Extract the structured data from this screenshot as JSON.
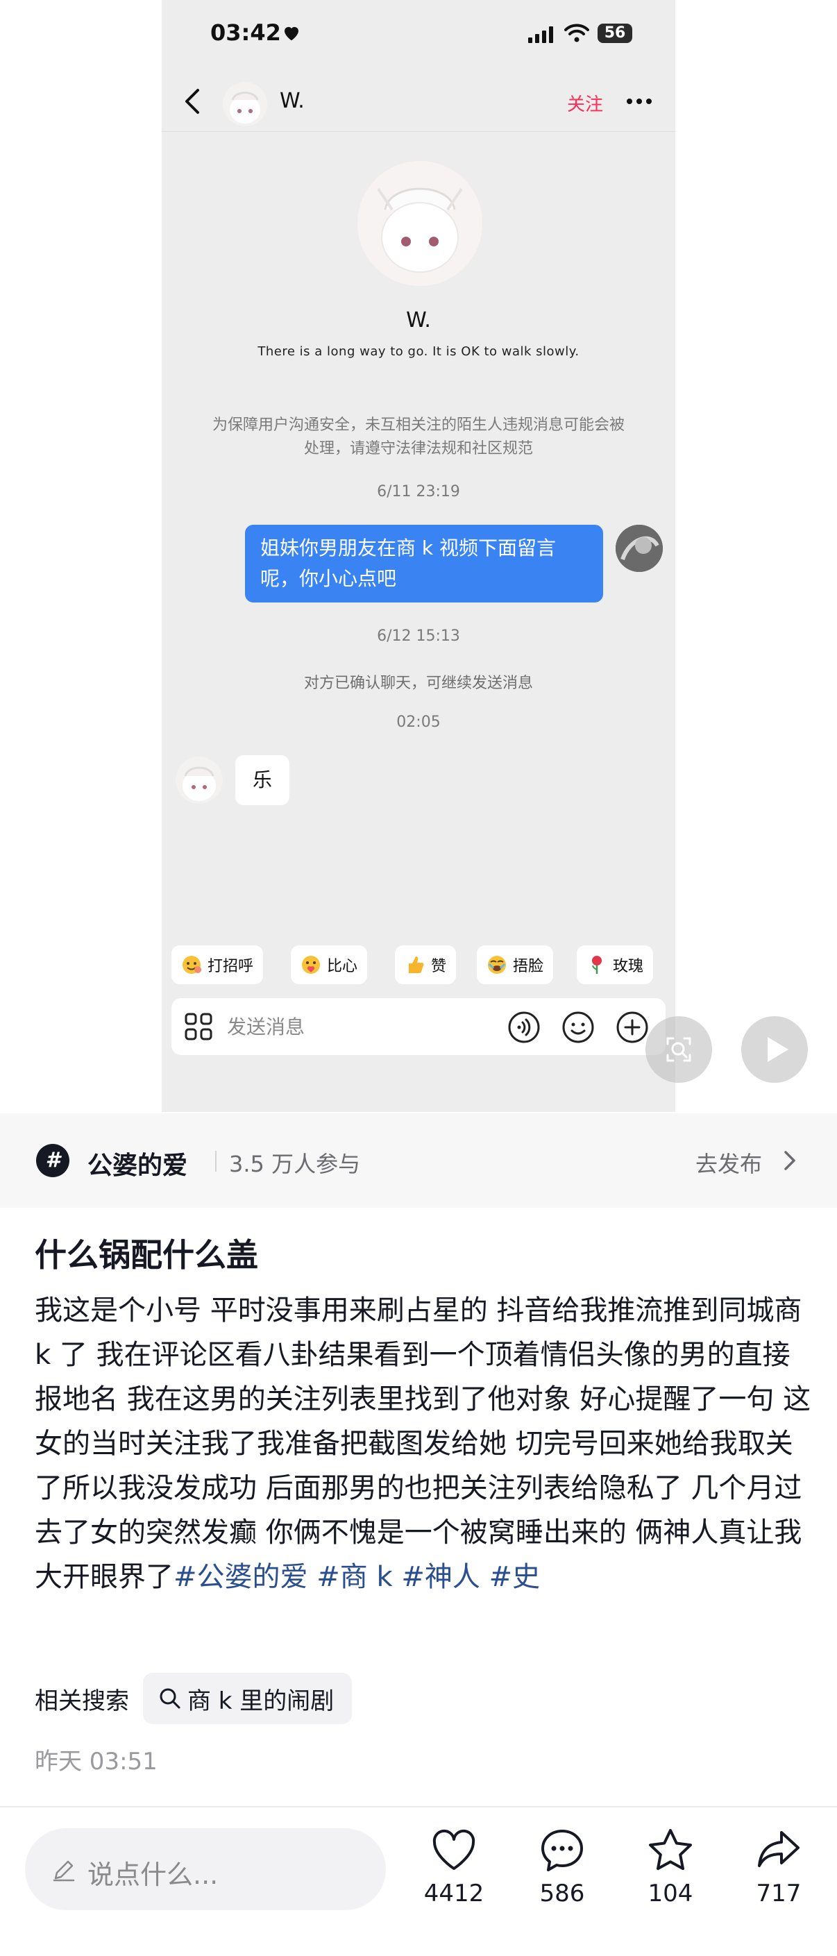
{
  "status_bar": {
    "time": "03:42",
    "battery": "56"
  },
  "chat_header": {
    "name": "W.",
    "follow_label": "关注"
  },
  "profile": {
    "name": "W.",
    "bio": "There is a long way to go. It is OK to walk slowly."
  },
  "safety_notice": "为保障用户沟通安全，未互相关注的陌生人违规消息可能会被处理，请遵守法律法规和社区规范",
  "messages": [
    {
      "type": "time",
      "text": "6/11 23:19"
    },
    {
      "type": "sent",
      "text": "姐妹你男朋友在商 k 视频下面留言呢，你小心点吧"
    },
    {
      "type": "time",
      "text": "6/12 15:13"
    },
    {
      "type": "system",
      "text": "对方已确认聊天，可继续发送消息"
    },
    {
      "type": "time",
      "text": "02:05"
    },
    {
      "type": "received",
      "text": "乐"
    }
  ],
  "quick_replies": [
    {
      "label": "打招呼",
      "icon": "greeting-emoji-icon"
    },
    {
      "label": "比心",
      "icon": "heart-hands-emoji-icon"
    },
    {
      "label": "赞",
      "icon": "thumbs-up-emoji-icon"
    },
    {
      "label": "捂脸",
      "icon": "facepalm-emoji-icon"
    },
    {
      "label": "玫瑰",
      "icon": "rose-emoji-icon"
    }
  ],
  "composer": {
    "placeholder": "发送消息"
  },
  "topic": {
    "name": "公婆的爱",
    "participants": "3.5 万人参与",
    "publish_label": "去发布"
  },
  "post": {
    "title": "什么锅配什么盖",
    "body": "我这是个小号 平时没事用来刷占星的 抖音给我推流推到同城商 k 了 我在评论区看八卦结果看到一个顶着情侣头像的男的直接报地名 我在这男的关注列表里找到了他对象 好心提醒了一句 这女的当时关注我了我准备把截图发给她 切完号回来她给我取关了所以我没发成功 后面那男的也把关注列表给隐私了 几个月过去了女的突然发癫 你俩不愧是一个被窝睡出来的 俩神人真让我大开眼界了",
    "hashtags": [
      "#公婆的爱",
      "#商 k",
      "#神人",
      "#史"
    ],
    "related_label": "相关搜索",
    "related_query": "商 k 里的闹剧",
    "date": "昨天 03:51"
  },
  "bottom_bar": {
    "comment_placeholder": "说点什么...",
    "likes": "4412",
    "comments": "586",
    "favorites": "104",
    "shares": "717"
  },
  "colors": {
    "accent_red": "#fe2c55",
    "bubble_blue": "#3a83f3",
    "hashtag_blue": "#2a4e8f"
  }
}
